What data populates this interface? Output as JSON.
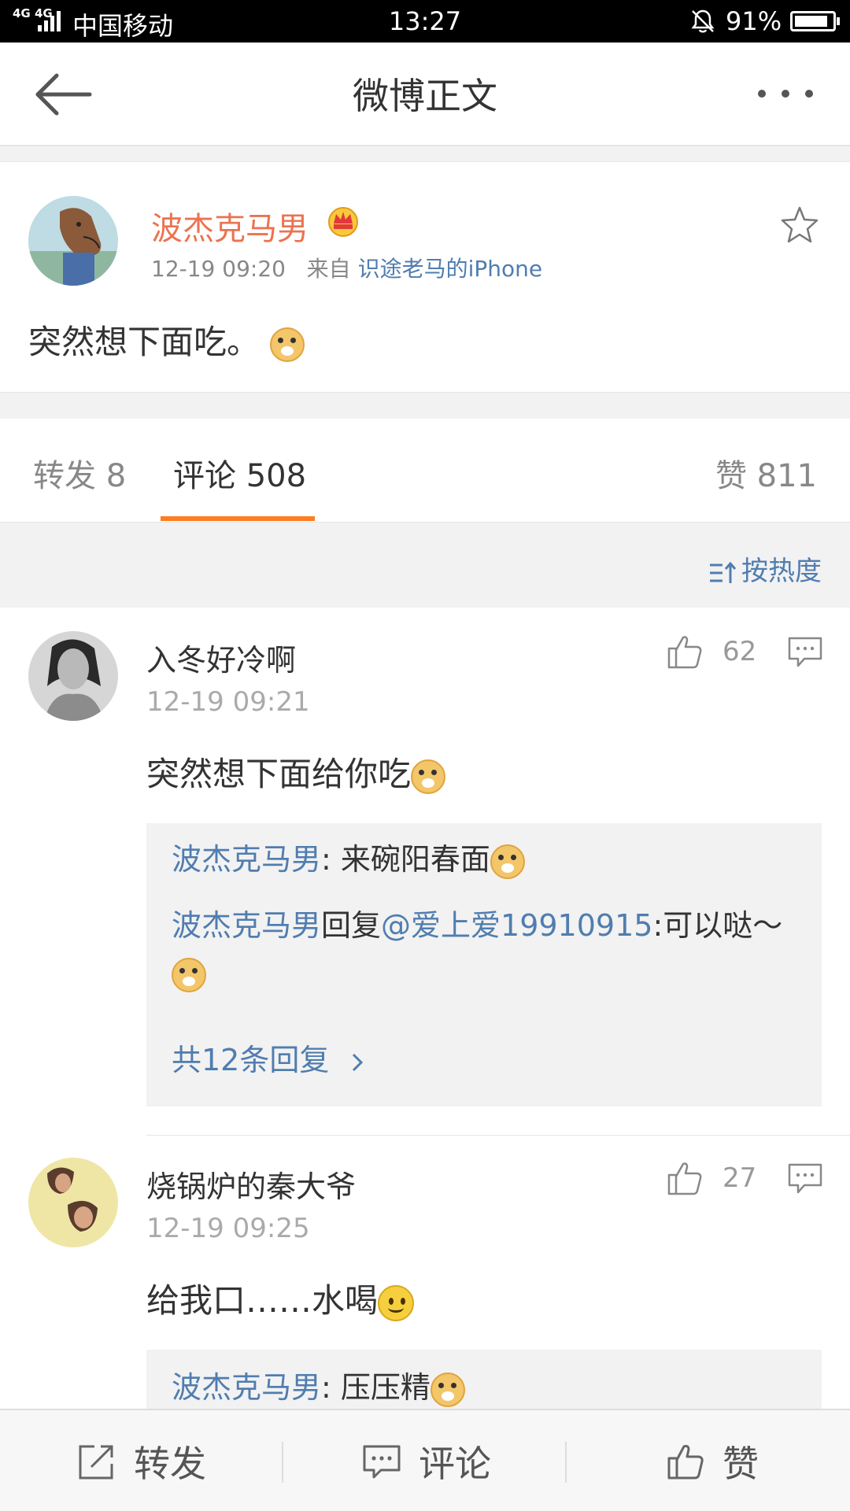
{
  "status_bar": {
    "network": "4G 4G",
    "carrier": "中国移动",
    "time": "13:27",
    "battery": "91%",
    "battery_level": 0.91
  },
  "nav": {
    "title": "微博正文",
    "back_icon": "back-arrow-icon",
    "more_icon": "more-dots-icon"
  },
  "post": {
    "author": "波杰克马男",
    "badge_icon": "crown-badge-icon",
    "time": "12-19 09:20",
    "from_label": "来自",
    "source": "识途老马的iPhone",
    "content": "突然想下面吃。",
    "emoji": "doge-emoji",
    "accent_color": "#eb7350"
  },
  "tabs": {
    "forward": "转发 8",
    "comments": "评论 508",
    "likes": "赞 811",
    "active_color": "#fe7d20"
  },
  "sort": {
    "label": "按热度"
  },
  "comments": [
    {
      "name": "入冬好冷啊",
      "time": "12-19 09:21",
      "text": "突然想下面给你吃",
      "emoji": "doge-emoji",
      "likes": "62",
      "replies": [
        {
          "user": "波杰克马男",
          "text": ": 来碗阳春面"
        },
        {
          "user": "波杰克马男",
          "mid": "回复",
          "mention": "@爱上爱19910915",
          "text": ":可以哒～"
        }
      ],
      "more_replies": "共12条回复"
    },
    {
      "name": "烧锅炉的秦大爷",
      "time": "12-19 09:25",
      "text": "给我口……水喝",
      "emoji": "smile-emoji",
      "likes": "27",
      "replies": [
        {
          "user": "波杰克马男",
          "text": ": 压压精"
        }
      ]
    }
  ],
  "bottom_bar": {
    "forward": "转发",
    "comment": "评论",
    "like": "赞"
  },
  "colors": {
    "link_blue": "#507daf",
    "text": "#333333",
    "muted": "#999999"
  }
}
